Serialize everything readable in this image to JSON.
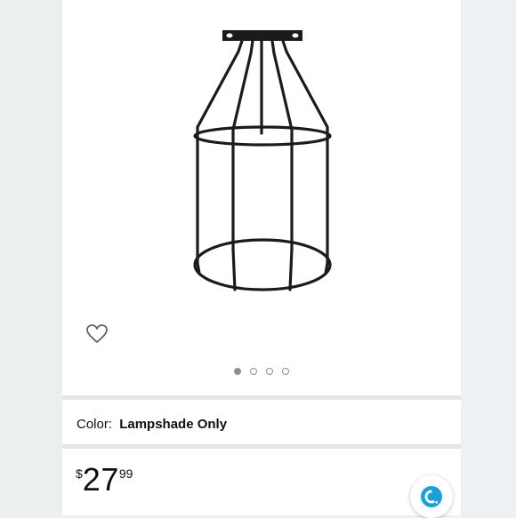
{
  "product": {
    "color_label": "Color:",
    "color_value": "Lampshade Only",
    "price": {
      "currency_symbol": "$",
      "whole": "27",
      "fraction": "99"
    }
  },
  "carousel": {
    "dot_count": 4,
    "active_index": 0
  },
  "icons": {
    "wishlist": "heart-outline-icon",
    "menu": "menu-icon",
    "assistant": "alexa-icon"
  },
  "colors": {
    "accent_alexa": "#1aa0d8",
    "text": "#0f1111",
    "divider": "#e3e6e6"
  }
}
